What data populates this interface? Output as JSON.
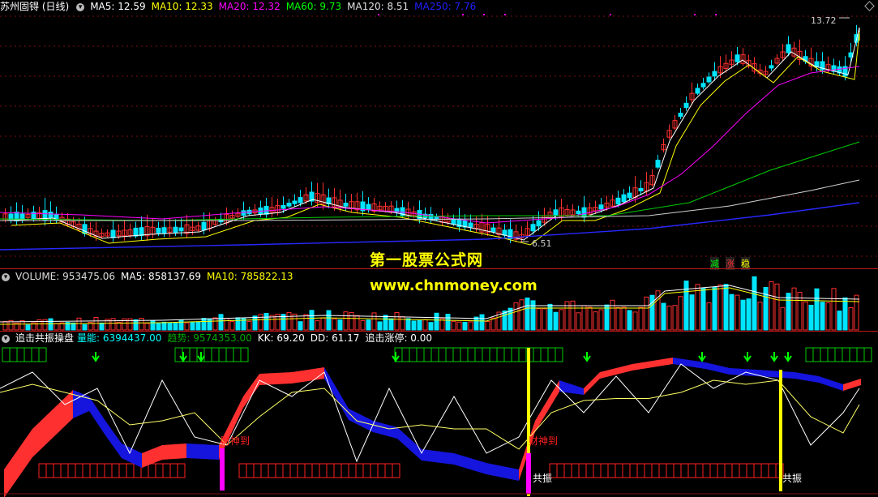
{
  "price_pane": {
    "title": "苏州固锝 (日线)",
    "ma_items": [
      {
        "label": "MA5: 12.59",
        "color": "#ffffff"
      },
      {
        "label": "MA10: 12.33",
        "color": "#ffff00"
      },
      {
        "label": "MA20: 12.32",
        "color": "#ff00ff"
      },
      {
        "label": "MA60: 9.73",
        "color": "#00ff00"
      },
      {
        "label": "MA120: 8.51",
        "color": "#e0e0e0"
      },
      {
        "label": "MA250: 7.76",
        "color": "#2020ff"
      }
    ],
    "high_label": "13.72",
    "low_label": "6.51",
    "tags": {
      "reduce": "减",
      "rise": "涨",
      "stable": "稳"
    }
  },
  "volume_pane": {
    "items": [
      {
        "label": "VOLUME: 953475.06",
        "color": "#dddddd"
      },
      {
        "label": "MA5: 858137.69",
        "color": "#ffffff"
      },
      {
        "label": "MA10: 785822.13",
        "color": "#ffff00"
      }
    ]
  },
  "indicator_pane": {
    "title": "追击共振操盘",
    "items": [
      {
        "label": "量能: 6394437.00",
        "color": "#00ffff"
      },
      {
        "label": "趋势: 9574353.00",
        "color": "#00aa00"
      },
      {
        "label": "KK: 69.20",
        "color": "#ffffff"
      },
      {
        "label": "DD: 61.17",
        "color": "#ffffff"
      },
      {
        "label": "追击涨停: 0.00",
        "color": "#ffffff"
      }
    ],
    "signals": {
      "god1": "财神到",
      "god2": "财神到",
      "res1": "共振",
      "res2": "共振"
    }
  },
  "watermark": {
    "line1": "第一股票公式网",
    "line2": "www.chnmoney.com"
  }
}
